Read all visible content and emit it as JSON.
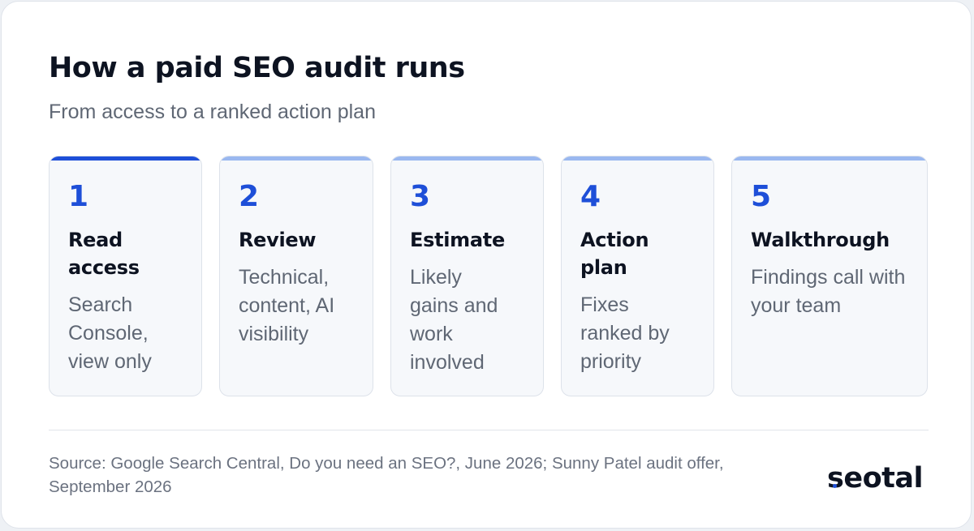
{
  "title": "How a paid SEO audit runs",
  "subtitle": "From access to a ranked action plan",
  "steps": [
    {
      "number": "1",
      "title": "Read access",
      "description": "Search Console, view only",
      "active": true
    },
    {
      "number": "2",
      "title": "Review",
      "description": "Technical, content, AI visibility",
      "active": false
    },
    {
      "number": "3",
      "title": "Estimate",
      "description": "Likely gains and work involved",
      "active": false
    },
    {
      "number": "4",
      "title": "Action plan",
      "description": "Fixes ranked by priority",
      "active": false
    },
    {
      "number": "5",
      "title": "Walkthrough",
      "description": "Findings call with your team",
      "active": false
    }
  ],
  "source": "Source: Google Search Central, Do you need an SEO?, June 2026; Sunny Patel audit offer, September 2026",
  "brand": {
    "logo_text": "seotal",
    "accent_color": "#1e4fd8",
    "inactive_accent_color": "#9ab8f0"
  }
}
